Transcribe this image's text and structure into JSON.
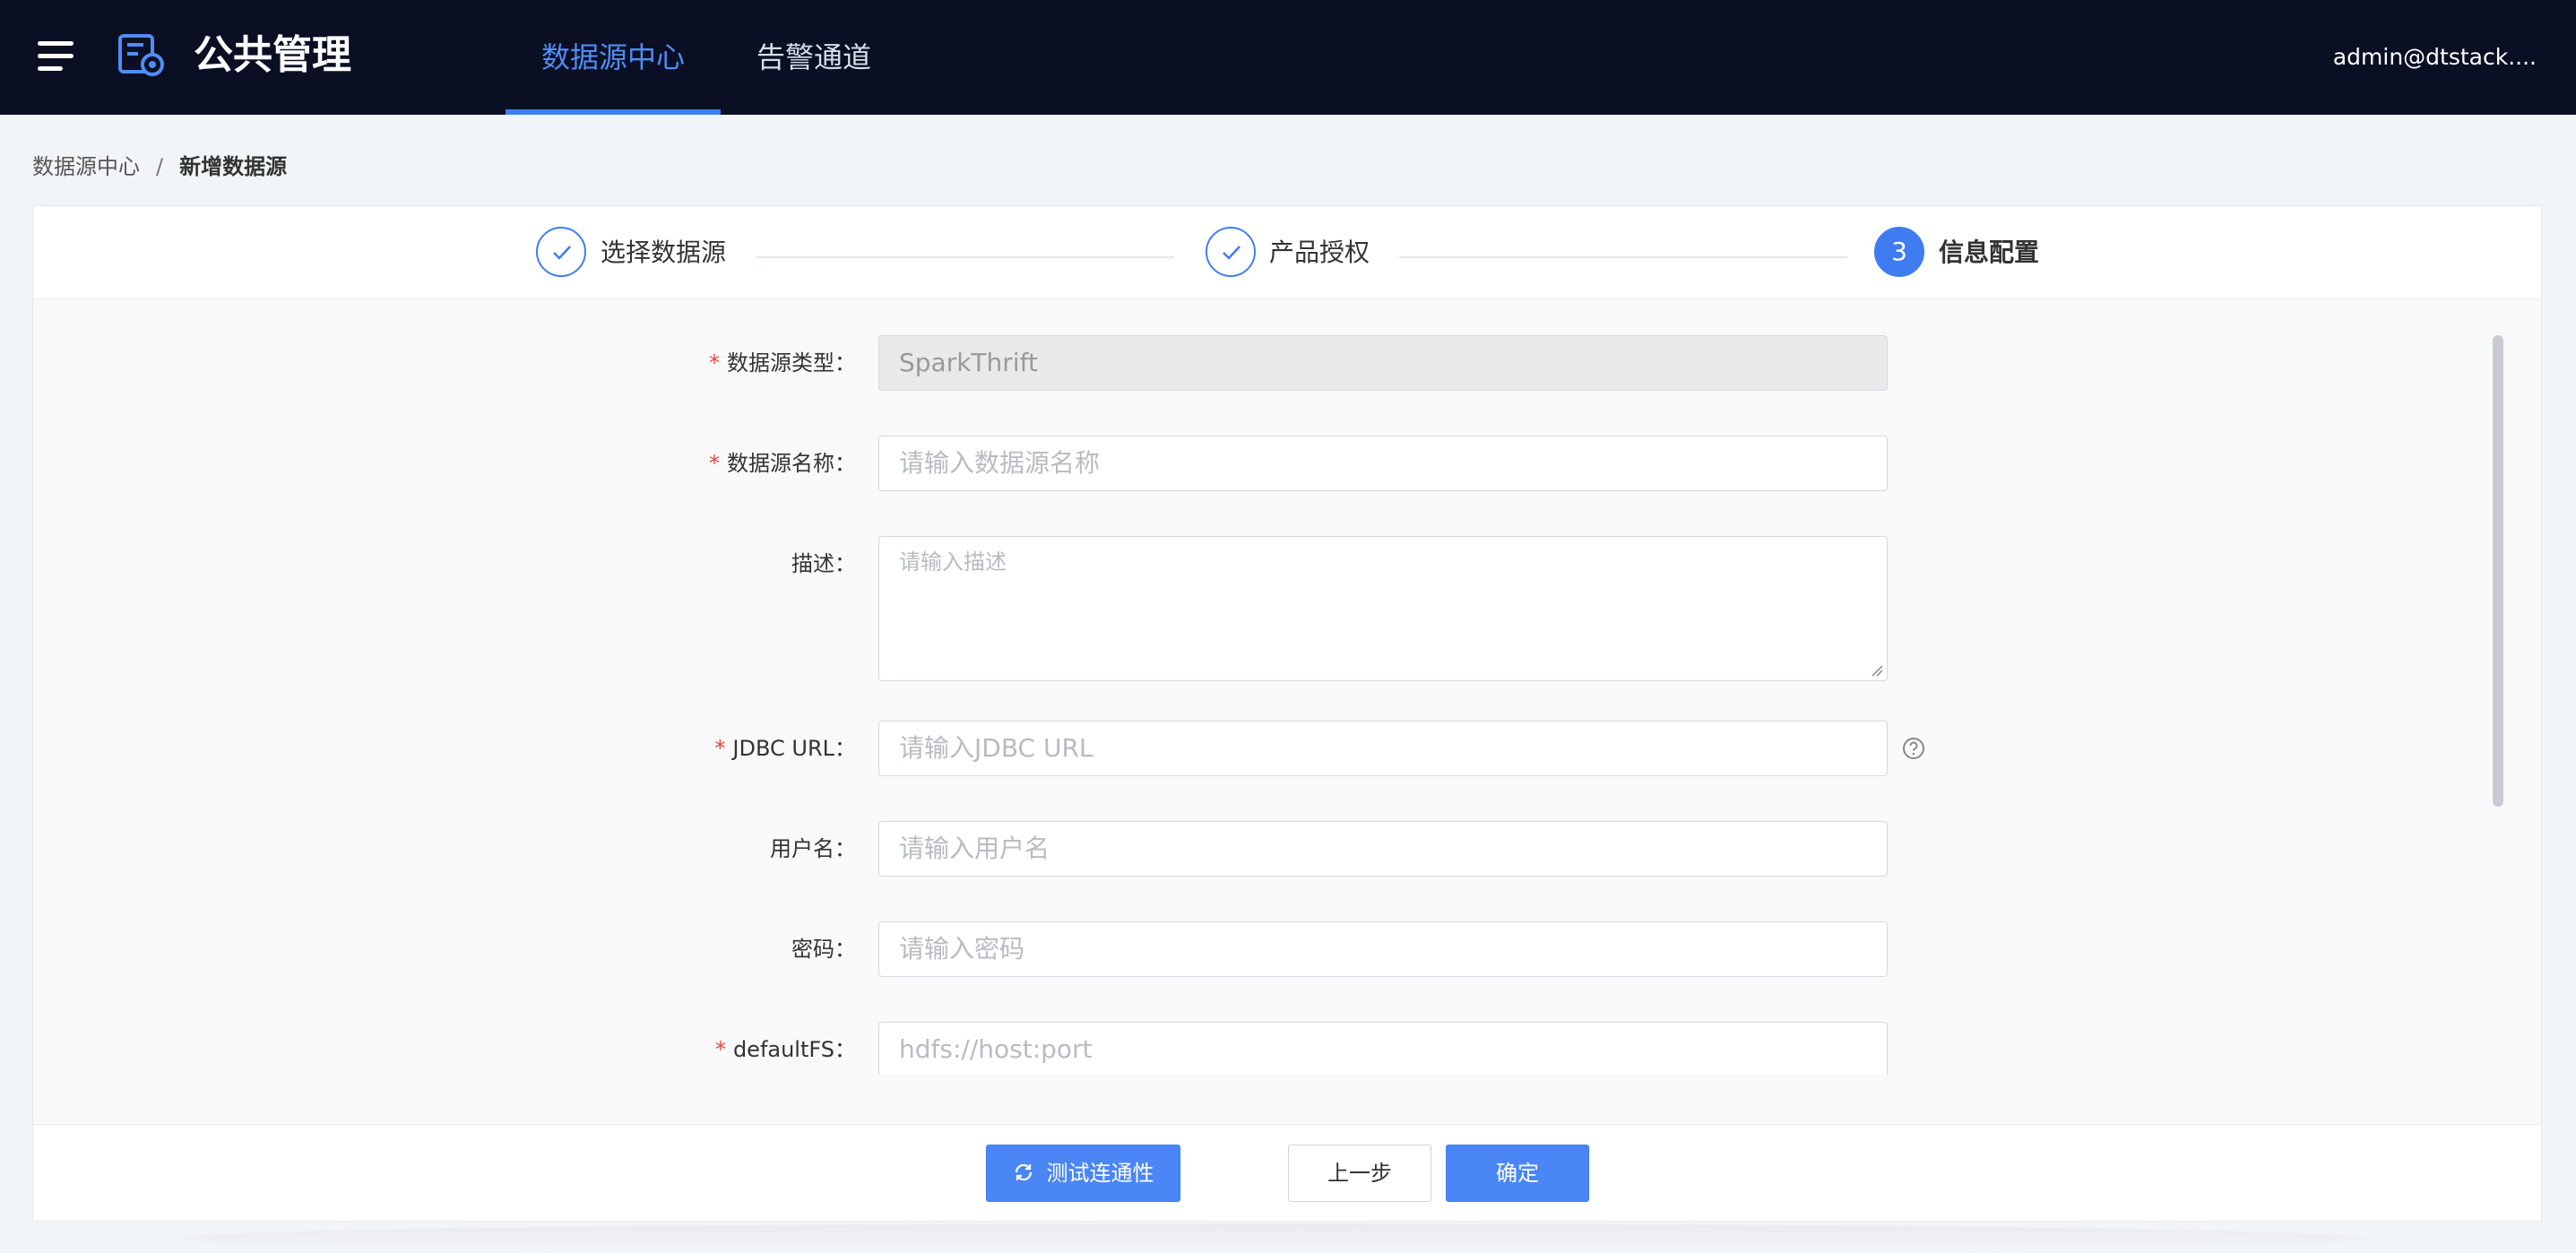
{
  "header": {
    "app_title": "公共管理",
    "nav_tabs": [
      {
        "label": "数据源中心",
        "active": true
      },
      {
        "label": "告警通道",
        "active": false
      }
    ],
    "user_name": "admin@dtstack...."
  },
  "breadcrumb": {
    "parent": "数据源中心",
    "separator": "/",
    "current": "新增数据源"
  },
  "steps": [
    {
      "label": "选择数据源",
      "status": "done"
    },
    {
      "label": "产品授权",
      "status": "done"
    },
    {
      "label": "信息配置",
      "status": "active",
      "number": "3"
    }
  ],
  "form": {
    "fields": [
      {
        "label": "数据源类型",
        "required": true,
        "value": "SparkThrift",
        "disabled": true
      },
      {
        "label": "数据源名称",
        "required": true,
        "placeholder": "请输入数据源名称"
      },
      {
        "label": "描述",
        "required": false,
        "placeholder": "请输入描述",
        "multiline": true
      },
      {
        "label": "JDBC URL",
        "required": true,
        "placeholder": "请输入JDBC URL",
        "help_icon": "question-circle-icon"
      },
      {
        "label": "用户名",
        "required": false,
        "placeholder": "请输入用户名"
      },
      {
        "label": "密码",
        "required": false,
        "placeholder": "请输入密码"
      },
      {
        "label": "defaultFS",
        "required": true,
        "placeholder": "hdfs://host:port"
      }
    ],
    "label_suffix": "："
  },
  "footer": {
    "test_button": "测试连通性",
    "prev_button": "上一步",
    "confirm_button": "确定"
  },
  "colors": {
    "header_bg": "#0a0f24",
    "accent": "#3f7cf2",
    "required": "#e54545"
  }
}
